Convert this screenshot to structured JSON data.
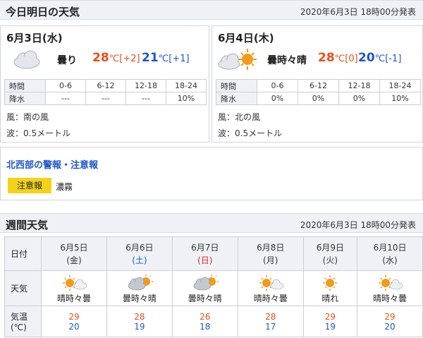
{
  "today_section": {
    "title": "今日明日の天気",
    "issued": "2020年6月3日 18時00分発表"
  },
  "today": {
    "date": "6月3日(水)",
    "weather": "曇り",
    "icon": "cloudy-icon",
    "high": "28",
    "high_unit": "℃",
    "high_diff": "[+2]",
    "low": "21",
    "low_unit": "℃",
    "low_diff": "[+1]",
    "rain_header": [
      "時間",
      "0-6",
      "6-12",
      "12-18",
      "18-24"
    ],
    "rain_values": [
      "降水",
      "---",
      "---",
      "---",
      "10%"
    ],
    "wind": "風：南の風",
    "wave": "波：0.5メートル"
  },
  "tomorrow": {
    "date": "6月4日(木)",
    "weather": "曇時々晴",
    "icon": "cloudy-sometimes-sunny-icon",
    "high": "28",
    "high_unit": "℃",
    "high_diff": "[0]",
    "low": "20",
    "low_unit": "℃",
    "low_diff": "[-1]",
    "rain_header": [
      "時間",
      "0-6",
      "6-12",
      "12-18",
      "18-24"
    ],
    "rain_values": [
      "降水",
      "0%",
      "0%",
      "0%",
      "10%"
    ],
    "wind": "風：北の風",
    "wave": "波：0.5メートル"
  },
  "warning": {
    "title": "北西部の警報・注意報",
    "badge": "注意報",
    "text": "濃霧"
  },
  "weekly_section": {
    "title": "週間天気",
    "issued": "2020年6月3日 18時00分発表"
  },
  "weekly": {
    "row_labels": {
      "date": "日付",
      "weather": "天気",
      "temp_line1": "気温",
      "temp_line2": "(℃)"
    },
    "days": [
      {
        "date": "6月5日",
        "dow": "(金)",
        "dow_type": "weekday",
        "weather": "晴時々曇",
        "icon": "sunny-sometimes-cloudy-icon",
        "high": "29",
        "low": "20"
      },
      {
        "date": "6月6日",
        "dow": "(土)",
        "dow_type": "sat",
        "weather": "曇時々晴",
        "icon": "cloudy-sometimes-sunny-icon",
        "high": "28",
        "low": "19"
      },
      {
        "date": "6月7日",
        "dow": "(日)",
        "dow_type": "sun",
        "weather": "曇時々晴",
        "icon": "cloudy-sometimes-sunny-icon",
        "high": "26",
        "low": "18"
      },
      {
        "date": "6月8日",
        "dow": "(月)",
        "dow_type": "weekday",
        "weather": "晴時々曇",
        "icon": "sunny-sometimes-cloudy-icon",
        "high": "28",
        "low": "17"
      },
      {
        "date": "6月9日",
        "dow": "(火)",
        "dow_type": "weekday",
        "weather": "晴れ",
        "icon": "sunny-icon",
        "high": "29",
        "low": "19"
      },
      {
        "date": "6月10日",
        "dow": "(水)",
        "dow_type": "weekday",
        "weather": "晴時々曇",
        "icon": "sunny-sometimes-cloudy-icon",
        "high": "29",
        "low": "20"
      }
    ]
  },
  "colors": {
    "high_temp": "#e8501a",
    "low_temp": "#1f56c9",
    "warning_badge": "#f3d31a",
    "sun": "#f39a1c",
    "cloud": "#d8dde2",
    "cloud_dark": "#a9b0b7"
  }
}
